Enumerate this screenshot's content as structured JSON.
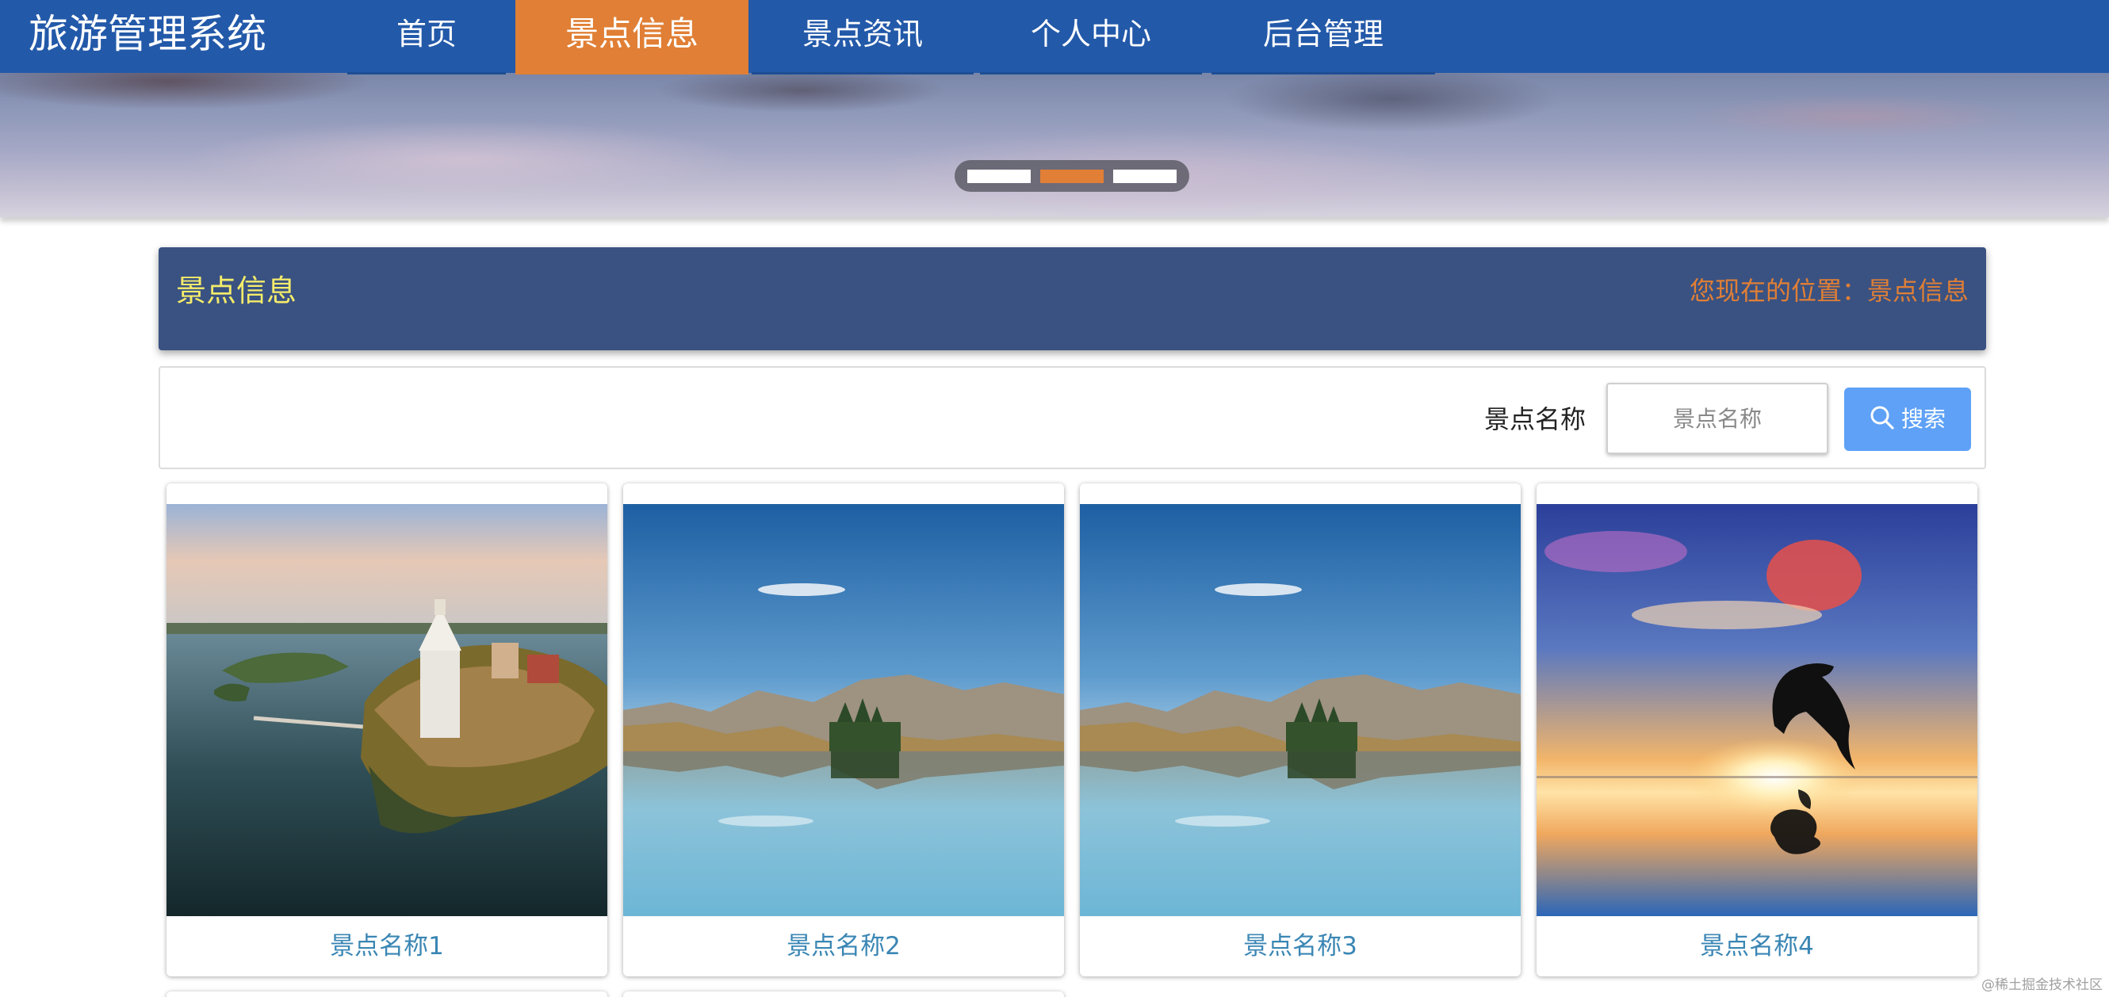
{
  "nav": {
    "brand": "旅游管理系统",
    "items": [
      {
        "label": "首页",
        "active": false
      },
      {
        "label": "景点信息",
        "active": true
      },
      {
        "label": "景点资讯",
        "active": false
      },
      {
        "label": "个人中心",
        "active": false
      },
      {
        "label": "后台管理",
        "active": false
      }
    ]
  },
  "carousel": {
    "slide_count": 3,
    "active_index": 1
  },
  "section": {
    "title": "景点信息",
    "breadcrumb": "您现在的位置：景点信息"
  },
  "search": {
    "label": "景点名称",
    "placeholder": "景点名称",
    "value": "",
    "button_label": "搜索",
    "button_icon": "search-icon"
  },
  "cards": [
    {
      "name": "景点名称1"
    },
    {
      "name": "景点名称2"
    },
    {
      "name": "景点名称3"
    },
    {
      "name": "景点名称4"
    }
  ],
  "watermark": "@稀土掘金技术社区",
  "colors": {
    "nav_bg": "#2359a9",
    "nav_active": "#e07f35",
    "section_bg": "#3a5282",
    "section_title": "#f4ec6a",
    "breadcrumb": "#e07f35",
    "search_button": "#5ea1f6",
    "card_name": "#3a86b4"
  }
}
